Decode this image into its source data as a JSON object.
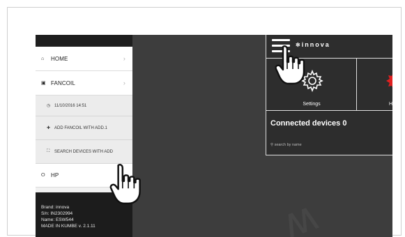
{
  "drawer": {
    "items": [
      {
        "label": "HOME",
        "icon": "home-icon"
      },
      {
        "label": "FANCOIL",
        "icon": "device-icon"
      }
    ],
    "sub_items": [
      {
        "label": "11/10/2016 14:51",
        "icon": "clock-icon"
      },
      {
        "label": "ADD FANCOIL WITH ADD.1",
        "icon": "plus-icon"
      },
      {
        "label": "SEARCH DEVICES WITH ADD",
        "icon": "scan-icon"
      }
    ],
    "hp_item": {
      "label": "HP",
      "icon": "circle-icon"
    },
    "info": {
      "brand": "Brand: innova",
      "serial": "S/n: IN2302994",
      "name": "Name: ESW544",
      "made": "MADE IN KUMBE v. 2.1.11"
    }
  },
  "app": {
    "logo_text": "innova",
    "tiles": [
      {
        "label": "Settings",
        "icon": "gear-icon"
      },
      {
        "label": "H",
        "icon": "red-gear-icon",
        "color": "#e02020"
      }
    ],
    "connected_label": "Connected devices 0",
    "search_placeholder": "search by name"
  },
  "colors": {
    "drawer_dark": "#1e1e1e",
    "background_dark": "#3d3d3d",
    "accent_red": "#e02020"
  }
}
